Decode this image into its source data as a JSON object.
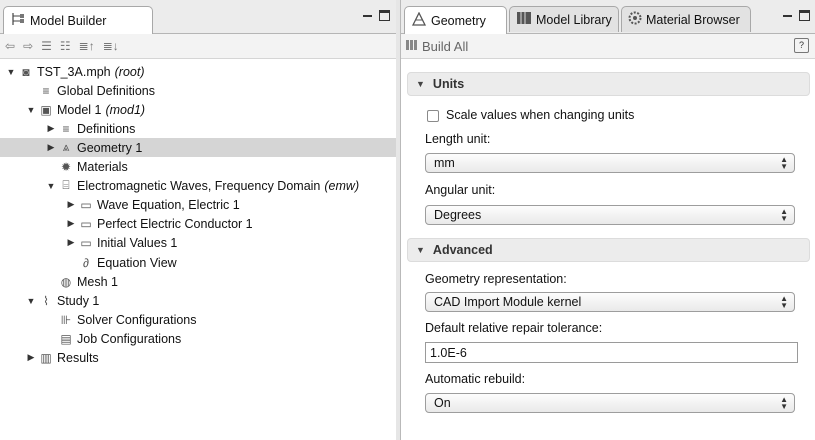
{
  "left": {
    "tab_title": "Model Builder",
    "tree": [
      {
        "label": "TST_3A.mph",
        "suffix": "(root)",
        "twisty": "open",
        "icon": "mph-file-icon",
        "depth": 0
      },
      {
        "label": "Global Definitions",
        "suffix": "",
        "twisty": "",
        "icon": "global-definitions-icon",
        "depth": 1
      },
      {
        "label": "Model 1",
        "suffix": "(mod1)",
        "twisty": "open",
        "icon": "model-icon",
        "depth": 1
      },
      {
        "label": "Definitions",
        "suffix": "",
        "twisty": "closed",
        "icon": "definitions-icon",
        "depth": 2
      },
      {
        "label": "Geometry 1",
        "suffix": "",
        "twisty": "closed",
        "icon": "geometry-icon",
        "depth": 2,
        "selected": true
      },
      {
        "label": "Materials",
        "suffix": "",
        "twisty": "",
        "icon": "materials-icon",
        "depth": 2
      },
      {
        "label": "Electromagnetic Waves, Frequency Domain",
        "suffix": "(emw)",
        "twisty": "open",
        "icon": "physics-interface-icon",
        "depth": 2
      },
      {
        "label": "Wave Equation, Electric 1",
        "suffix": "",
        "twisty": "closed",
        "icon": "domain-feature-icon",
        "depth": 3
      },
      {
        "label": "Perfect Electric Conductor 1",
        "suffix": "",
        "twisty": "closed",
        "icon": "boundary-feature-icon",
        "depth": 3
      },
      {
        "label": "Initial Values 1",
        "suffix": "",
        "twisty": "closed",
        "icon": "domain-feature-icon",
        "depth": 3
      },
      {
        "label": "Equation View",
        "suffix": "",
        "twisty": "",
        "icon": "equation-icon",
        "depth": 3
      },
      {
        "label": "Mesh 1",
        "suffix": "",
        "twisty": "",
        "icon": "mesh-icon",
        "depth": 2
      },
      {
        "label": "Study 1",
        "suffix": "",
        "twisty": "open",
        "icon": "study-icon",
        "depth": 1
      },
      {
        "label": "Solver Configurations",
        "suffix": "",
        "twisty": "",
        "icon": "solver-configurations-icon",
        "depth": 2
      },
      {
        "label": "Job Configurations",
        "suffix": "",
        "twisty": "",
        "icon": "job-configurations-icon",
        "depth": 2
      },
      {
        "label": "Results",
        "suffix": "",
        "twisty": "closed",
        "icon": "results-icon",
        "depth": 1
      }
    ]
  },
  "right": {
    "tabs": [
      "Geometry",
      "Model Library",
      "Material Browser"
    ],
    "active_tab": 0,
    "build_all": "Build All",
    "units": {
      "title": "Units",
      "scale_checkbox": "Scale values when changing units",
      "scale_checked": false,
      "length_label": "Length unit:",
      "length_value": "mm",
      "angular_label": "Angular unit:",
      "angular_value": "Degrees"
    },
    "advanced": {
      "title": "Advanced",
      "geom_rep_label": "Geometry representation:",
      "geom_rep_value": "CAD Import Module kernel",
      "tolerance_label": "Default relative repair tolerance:",
      "tolerance_value": "1.0E-6",
      "rebuild_label": "Automatic rebuild:",
      "rebuild_value": "On"
    }
  },
  "colors": {
    "selection": "#d5d5d5",
    "panel_header": "#ececec"
  }
}
